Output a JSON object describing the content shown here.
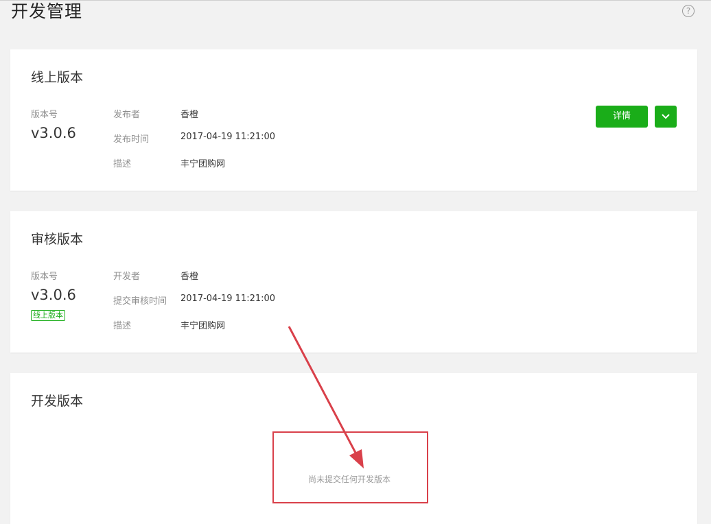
{
  "page": {
    "title": "开发管理",
    "help_icon": "?"
  },
  "online_version": {
    "title": "线上版本",
    "version_label": "版本号",
    "version": "v3.0.6",
    "publisher_label": "发布者",
    "publisher": "香橙",
    "publish_time_label": "发布时间",
    "publish_time": "2017-04-19 11:21:00",
    "desc_label": "描述",
    "desc": "丰宁团购网",
    "detail_button": "详情"
  },
  "review_version": {
    "title": "审核版本",
    "version_label": "版本号",
    "version": "v3.0.6",
    "badge": "线上版本",
    "developer_label": "开发者",
    "developer": "香橙",
    "submit_time_label": "提交审核时间",
    "submit_time": "2017-04-19 11:21:00",
    "desc_label": "描述",
    "desc": "丰宁团购网"
  },
  "dev_version": {
    "title": "开发版本",
    "empty_text": "尚未提交任何开发版本"
  },
  "colors": {
    "accent": "#1aad19",
    "annotation": "#d9404a",
    "background": "#f2f2f2"
  }
}
